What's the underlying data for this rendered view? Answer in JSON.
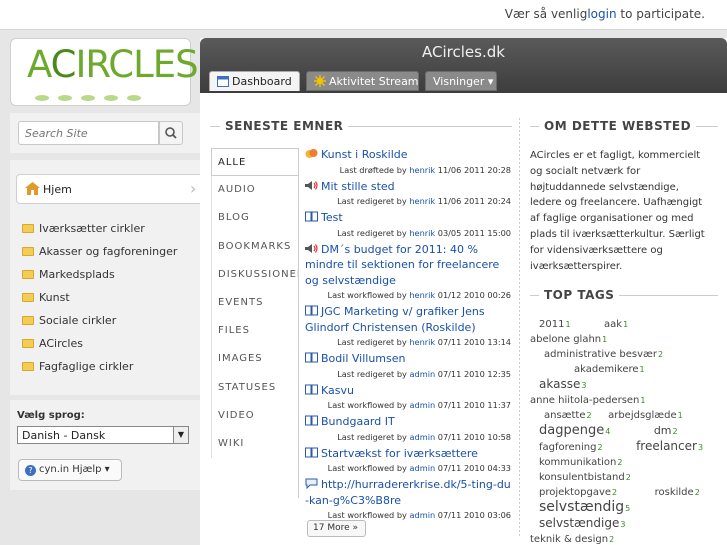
{
  "topbar": {
    "prefix": "Vær så venlig",
    "login": "login",
    "suffix": " to participate."
  },
  "logo": {
    "text_a": "A",
    "text_c": "C",
    "text_rest": "IRCLES"
  },
  "search": {
    "placeholder": "Search Site",
    "icon": "magnifier-icon"
  },
  "nav": {
    "home": "Hjem",
    "items": [
      "Iværksætter cirkler",
      "Akasser og fagforeninger",
      "Markedsplads",
      "Kunst",
      "Sociale cirkler",
      "ACircles",
      "Fagfaglige cirkler"
    ]
  },
  "language": {
    "title": "Vælg sprog:",
    "selected": "Danish - Dansk",
    "help": "cyn.in Hjælp ▾"
  },
  "main": {
    "site_title": "ACircles.dk",
    "tabs": {
      "dashboard": "Dashboard",
      "stream": "Aktivitet Stream",
      "views": "Visninger ▾"
    },
    "latest_title": "SENESTE EMNER",
    "filters": [
      "ALLE",
      "AUDIO",
      "BLOG",
      "BOOKMARKS",
      "DISKUSSIONER",
      "EVENTS",
      "FILES",
      "IMAGES",
      "STATUSES",
      "VIDEO",
      "WIKI"
    ],
    "topics": [
      {
        "title": "Kunst i Roskilde",
        "action": "Last drøftede by ",
        "user": "henrik",
        "date": " 11/06 2011 20:28",
        "icon": "discussion-icon"
      },
      {
        "title": "Mit stille sted",
        "action": "Last redigeret by ",
        "user": "henrik",
        "date": " 11/06 2011 20:24",
        "icon": "audio-icon"
      },
      {
        "title": "Test",
        "action": "Last redigeret by ",
        "user": "henrik",
        "date": " 03/05 2011 15:00",
        "icon": "wiki-icon"
      },
      {
        "title": "DM´s budget for 2011: 40 % mindre til sektionen for freelancere og selvstændige",
        "action": "Last workflowed by ",
        "user": "henrik",
        "date": " 01/12 2010 00:26",
        "icon": "audio-icon"
      },
      {
        "title": "JGC Marketing v/ grafiker Jens Glindorf Christensen (Roskilde)",
        "action": "Last redigeret by ",
        "user": "henrik",
        "date": " 07/11 2010 13:14",
        "icon": "wiki-icon"
      },
      {
        "title": "Bodil Villumsen",
        "action": "Last redigeret by ",
        "user": "admin",
        "date": " 07/11 2010 12:35",
        "icon": "wiki-icon"
      },
      {
        "title": "Kasvu",
        "action": "Last workflowed by ",
        "user": "admin",
        "date": " 07/11 2010 11:37",
        "icon": "wiki-icon"
      },
      {
        "title": "Bundgaard IT",
        "action": "Last redigeret by ",
        "user": "admin",
        "date": " 07/11 2010 10:58",
        "icon": "wiki-icon"
      },
      {
        "title": "Startvækst for iværksættere",
        "action": "Last workflowed by ",
        "user": "admin",
        "date": " 07/11 2010 04:33",
        "icon": "wiki-icon"
      },
      {
        "title": "http://hurradererkrise.dk/5-ting-du-kan-g%C3%B8re",
        "action": "Last workflowed by ",
        "user": "admin",
        "date": " 07/11 2010 03:06",
        "icon": "status-icon"
      }
    ],
    "more": "17 More »",
    "about_title": "OM DETTE WEBSTED",
    "about_text": "ACircles er et fagligt, kommercielt og socialt netværk for højtuddannede selvstændige, ledere og freelancere. Uafhængigt af faglige organisationer og med plads til iværksætterkultur. Særligt for vidensiværksættere og iværksætterspirer.",
    "tags_title": "TOP TAGS",
    "tags": [
      {
        "name": "2011",
        "count": "1"
      },
      {
        "name": "aak",
        "count": "1"
      },
      {
        "name": "abelone glahn",
        "count": "1"
      },
      {
        "name": "administrative besvær",
        "count": "2"
      },
      {
        "name": "akademikere",
        "count": "1"
      },
      {
        "name": "akasse",
        "count": "3"
      },
      {
        "name": "anne hiitola-pedersen",
        "count": "1"
      },
      {
        "name": "ansætte",
        "count": "2"
      },
      {
        "name": "arbejdsglæde",
        "count": "1"
      },
      {
        "name": "dagpenge",
        "count": "4"
      },
      {
        "name": "dm",
        "count": "2"
      },
      {
        "name": "fagforening",
        "count": "2"
      },
      {
        "name": "freelancer",
        "count": "3"
      },
      {
        "name": "kommunikation",
        "count": "2"
      },
      {
        "name": "konsulentbistand",
        "count": "2"
      },
      {
        "name": "projektopgave",
        "count": "2"
      },
      {
        "name": "roskilde",
        "count": "2"
      },
      {
        "name": "selvstændig",
        "count": "5"
      },
      {
        "name": "selvstændige",
        "count": "3"
      },
      {
        "name": "teknik & design",
        "count": "2"
      }
    ]
  }
}
